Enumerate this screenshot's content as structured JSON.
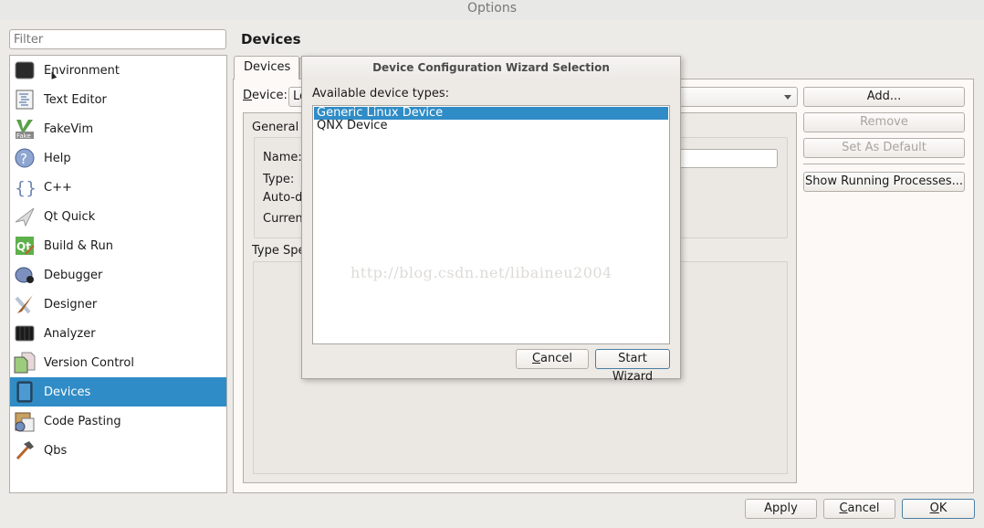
{
  "window": {
    "title": "Options"
  },
  "filter": {
    "placeholder": "Filter",
    "value": ""
  },
  "sidebar": {
    "items": [
      {
        "label": "Environment",
        "icon": "environment-icon",
        "selected": false
      },
      {
        "label": "Text Editor",
        "icon": "text-editor-icon",
        "selected": false
      },
      {
        "label": "FakeVim",
        "icon": "fakevim-icon",
        "selected": false
      },
      {
        "label": "Help",
        "icon": "help-icon",
        "selected": false
      },
      {
        "label": "C++",
        "icon": "cpp-braces-icon",
        "selected": false
      },
      {
        "label": "Qt Quick",
        "icon": "paper-plane-icon",
        "selected": false
      },
      {
        "label": "Build & Run",
        "icon": "qt-build-icon",
        "selected": false
      },
      {
        "label": "Debugger",
        "icon": "bug-icon",
        "selected": false
      },
      {
        "label": "Designer",
        "icon": "designer-brush-icon",
        "selected": false
      },
      {
        "label": "Analyzer",
        "icon": "analyzer-icon",
        "selected": false
      },
      {
        "label": "Version Control",
        "icon": "version-control-icon",
        "selected": false
      },
      {
        "label": "Devices",
        "icon": "device-icon",
        "selected": true
      },
      {
        "label": "Code Pasting",
        "icon": "code-pasting-icon",
        "selected": false
      },
      {
        "label": "Qbs",
        "icon": "hammer-icon",
        "selected": false
      }
    ]
  },
  "page": {
    "title": "Devices",
    "tabs": [
      {
        "label": "Devices",
        "active": true
      }
    ],
    "device_label": "Device:",
    "device_value": "Lo",
    "buttons": {
      "add": "Add...",
      "remove": "Remove",
      "set_default": "Set As Default",
      "show_processes": "Show Running Processes..."
    },
    "general": {
      "title": "General",
      "fields": [
        "Name:",
        "Type:",
        "Auto-d",
        "Curren"
      ]
    },
    "type_specific": {
      "title": "Type Spe"
    }
  },
  "dialog": {
    "title": "Device Configuration Wizard Selection",
    "list_label": "Available device types:",
    "items": [
      {
        "label": "Generic Linux Device",
        "selected": true
      },
      {
        "label": "QNX Device",
        "selected": false
      }
    ],
    "cancel": "Cancel",
    "start": "Start Wizard"
  },
  "footer": {
    "apply": "Apply",
    "cancel": "Cancel",
    "ok": "OK"
  },
  "watermark": "http://blog.csdn.net/libaineu2004",
  "colors": {
    "selection": "#308cc6",
    "background": "#edebe7"
  }
}
